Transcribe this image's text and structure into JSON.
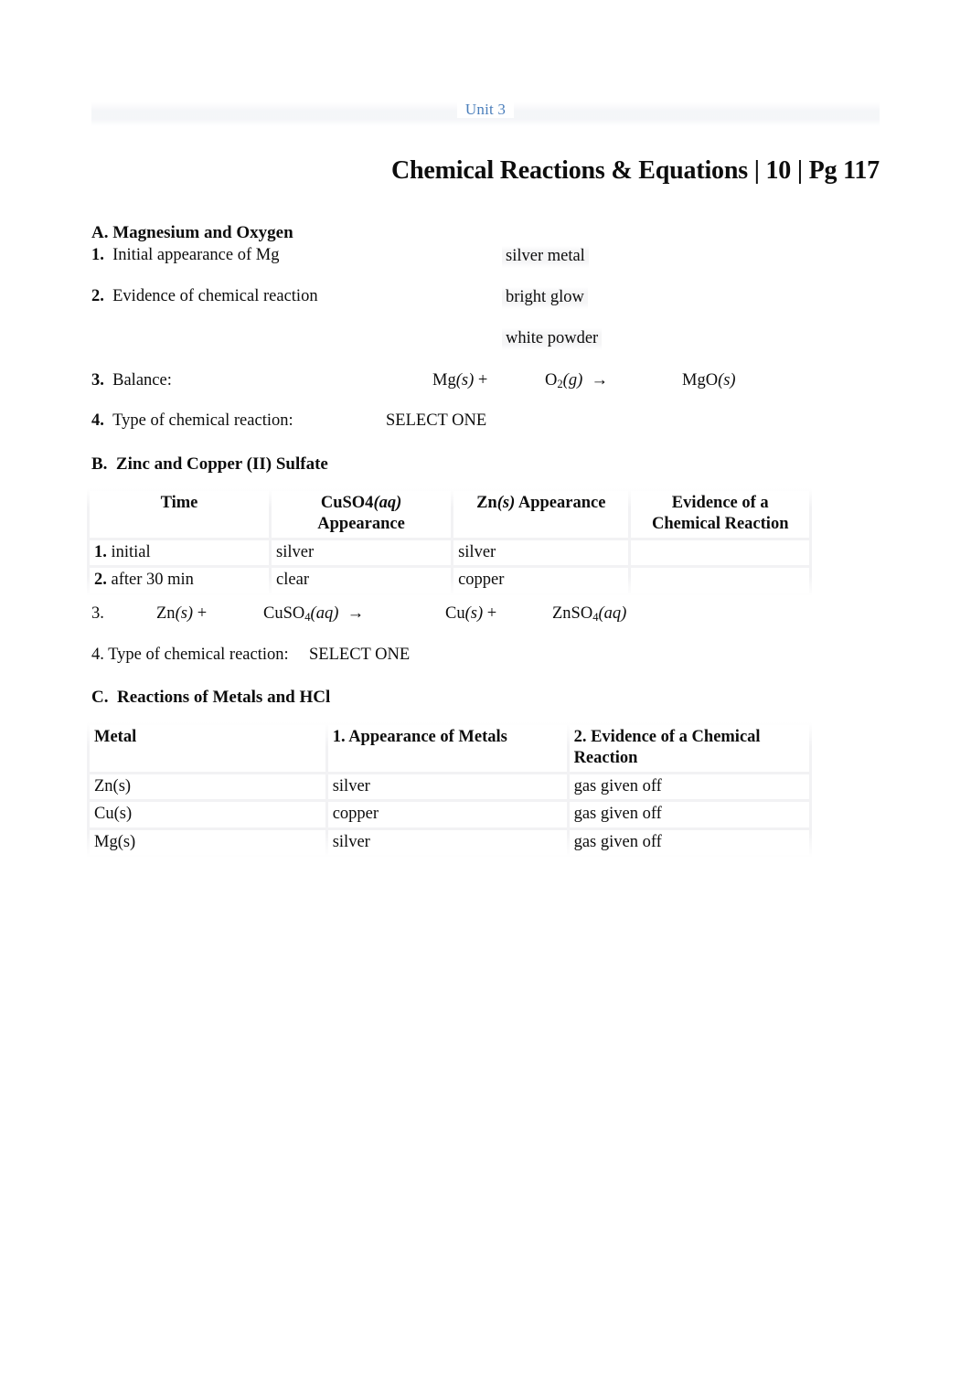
{
  "header": {
    "unit_label": "Unit 3",
    "unit_color": "#4a7ebb",
    "title": "Chemical Reactions & Equations | 10 | Pg 117"
  },
  "section_a": {
    "heading": "A. Magnesium and Oxygen",
    "q1_num": "1.",
    "q1_text": "Initial appearance of Mg",
    "q1_answer": "silver metal",
    "q2_num": "2.",
    "q2_text": "Evidence of chemical reaction",
    "q2_answer_1": "bright glow",
    "q2_answer_2": "white powder",
    "q3_num": "3.",
    "q3_text": "Balance:",
    "equation": {
      "reactant_1_formula": "Mg",
      "reactant_1_state": "(s)",
      "plus_1": "+",
      "reactant_2_formula": "O",
      "reactant_2_sub": "2",
      "reactant_2_state": "(g)",
      "arrow": "→",
      "product_1_formula": "MgO",
      "product_1_state": "(s)"
    },
    "q4_num": "4.",
    "q4_text": "Type of chemical reaction:",
    "q4_answer": "SELECT ONE"
  },
  "section_b": {
    "heading": "B.  Zinc and Copper (II) Sulfate",
    "table": {
      "headers": [
        "Time",
        "CuSO4(aq)\nAppearance",
        "Zn(s) Appearance",
        "Evidence of a\nChemical Reaction"
      ],
      "header_parts": {
        "c1": "Time",
        "c2_line1_main": "CuSO4",
        "c2_line1_state": "(aq)",
        "c2_line2": "Appearance",
        "c3_main_1": "Zn",
        "c3_state": "(s)",
        "c3_main_2": " Appearance",
        "c4_line1": "Evidence of a",
        "c4_line2": "Chemical Reaction"
      },
      "rows": [
        {
          "num": "1.",
          "time": "initial",
          "cuso4": "silver",
          "zn": "silver",
          "evidence": ""
        },
        {
          "num": "2.",
          "time": "after 30 min",
          "cuso4": "clear",
          "zn": "copper",
          "evidence": ""
        }
      ]
    },
    "q3_num": "3.",
    "equation": {
      "reactant_1_formula": "Zn",
      "reactant_1_state": "(s)",
      "plus_1": "+",
      "reactant_2_formula": "CuSO",
      "reactant_2_sub": "4",
      "reactant_2_state": "(aq)",
      "arrow": "→",
      "product_1_formula": "Cu",
      "product_1_state": "(s)",
      "plus_2": "+",
      "product_2_formula": "ZnSO",
      "product_2_sub": "4",
      "product_2_state": "(aq)"
    },
    "q4_text": "4. Type of chemical reaction:",
    "q4_answer": "SELECT ONE"
  },
  "section_c": {
    "heading": "C.  Reactions of Metals and HCl",
    "table": {
      "headers": [
        "Metal",
        "1.  Appearance of Metals",
        "2.  Evidence of a Chemical Reaction"
      ],
      "header_parts": {
        "c1": "Metal",
        "c2": "1.  Appearance of Metals",
        "c3_line1": "2.  Evidence of a Chemical",
        "c3_line2": "Reaction"
      },
      "rows": [
        {
          "metal": "Zn(s)",
          "appearance": "silver",
          "evidence": "gas given off"
        },
        {
          "metal": "Cu(s)",
          "appearance": "copper",
          "evidence": "gas given off"
        },
        {
          "metal": "Mg(s)",
          "appearance": "silver",
          "evidence": "gas given off"
        }
      ]
    }
  }
}
